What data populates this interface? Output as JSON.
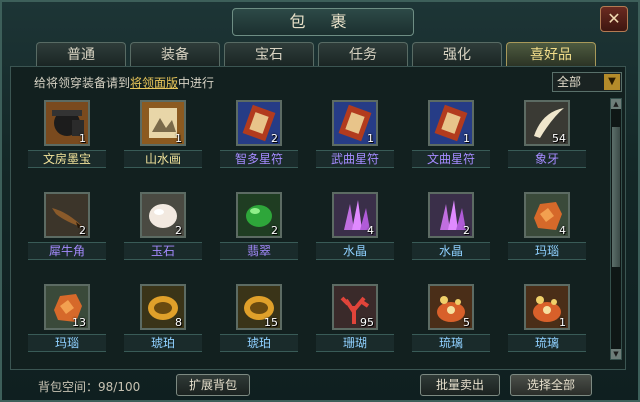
{
  "window": {
    "title": "包 裹",
    "close_icon": "close-icon"
  },
  "tabs": [
    {
      "label": "普通",
      "active": false
    },
    {
      "label": "装备",
      "active": false
    },
    {
      "label": "宝石",
      "active": false
    },
    {
      "label": "任务",
      "active": false
    },
    {
      "label": "强化",
      "active": false
    },
    {
      "label": "喜好品",
      "active": true
    }
  ],
  "hint": {
    "prefix": "给将领穿装备请到",
    "link": "将领面版",
    "suffix": "中进行"
  },
  "filter": {
    "selected": "全部"
  },
  "items": [
    {
      "name": "文房墨宝",
      "qty": "1",
      "color": "#f1e29a",
      "icon": "inkstone-icon"
    },
    {
      "name": "山水画",
      "qty": "1",
      "color": "#f1e29a",
      "icon": "scroll-painting-icon"
    },
    {
      "name": "智多星符",
      "qty": "2",
      "color": "#a58bff",
      "icon": "talisman-icon"
    },
    {
      "name": "武曲星符",
      "qty": "1",
      "color": "#a58bff",
      "icon": "talisman-icon"
    },
    {
      "name": "文曲星符",
      "qty": "1",
      "color": "#a58bff",
      "icon": "talisman-icon"
    },
    {
      "name": "象牙",
      "qty": "54",
      "color": "#a58bff",
      "icon": "ivory-icon"
    },
    {
      "name": "犀牛角",
      "qty": "2",
      "color": "#a58bff",
      "icon": "rhino-horn-icon"
    },
    {
      "name": "玉石",
      "qty": "2",
      "color": "#a58bff",
      "icon": "jade-stone-icon"
    },
    {
      "name": "翡翠",
      "qty": "2",
      "color": "#a58bff",
      "icon": "emerald-icon"
    },
    {
      "name": "水晶",
      "qty": "4",
      "color": "#8fd0ff",
      "icon": "crystal-icon"
    },
    {
      "name": "水晶",
      "qty": "2",
      "color": "#8fd0ff",
      "icon": "crystal-icon"
    },
    {
      "name": "玛瑙",
      "qty": "4",
      "color": "#8fd0ff",
      "icon": "agate-icon"
    },
    {
      "name": "玛瑙",
      "qty": "13",
      "color": "#8fd0ff",
      "icon": "agate-icon"
    },
    {
      "name": "琥珀",
      "qty": "8",
      "color": "#8fd0ff",
      "icon": "amber-icon"
    },
    {
      "name": "琥珀",
      "qty": "15",
      "color": "#8fd0ff",
      "icon": "amber-icon"
    },
    {
      "name": "珊瑚",
      "qty": "95",
      "color": "#8fd0ff",
      "icon": "coral-icon"
    },
    {
      "name": "琉璃",
      "qty": "5",
      "color": "#8fd0ff",
      "icon": "glaze-icon"
    },
    {
      "name": "琉璃",
      "qty": "1",
      "color": "#8fd0ff",
      "icon": "glaze-icon"
    }
  ],
  "footer": {
    "capacity": "背包空间：98/100",
    "expand": "扩展背包",
    "batch_sell": "批量卖出",
    "select_all": "选择全部"
  }
}
